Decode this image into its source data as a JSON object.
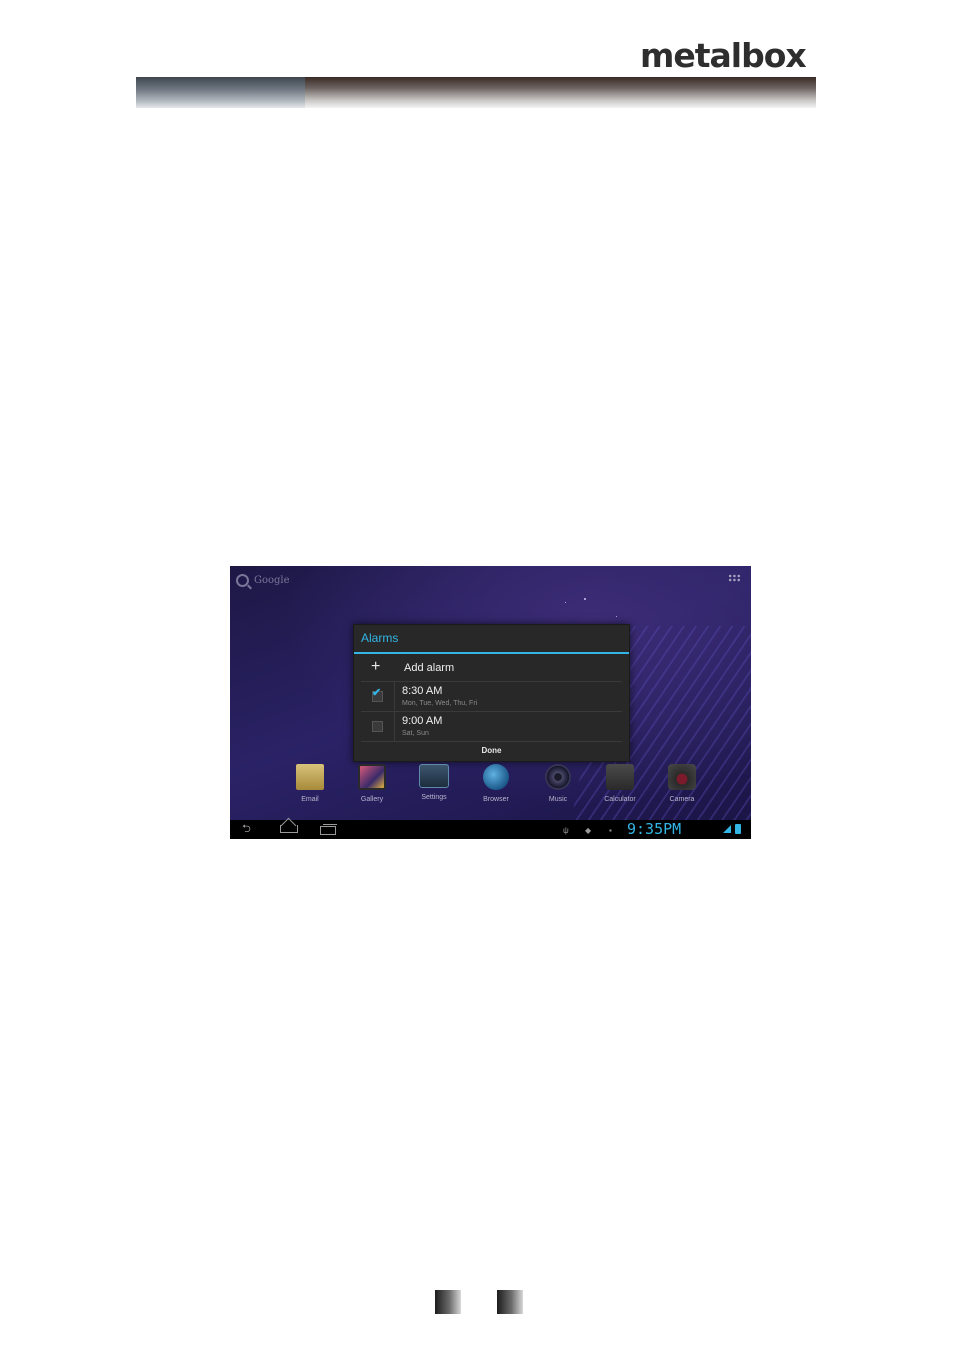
{
  "page": {
    "logo_text": "metalbox"
  },
  "screen": {
    "search_label": "Google",
    "dialog": {
      "title": "Alarms",
      "add_label": "Add alarm",
      "alarms": [
        {
          "time": "8:30 AM",
          "days": "Mon, Tue, Wed, Thu, Fri",
          "enabled": true
        },
        {
          "time": "9:00 AM",
          "days": "Sat, Sun",
          "enabled": false
        }
      ],
      "done_label": "Done"
    },
    "dock": [
      {
        "label": "Email",
        "icon": "email-icon"
      },
      {
        "label": "Gallery",
        "icon": "gallery-icon"
      },
      {
        "label": "Settings",
        "icon": "settings-icon"
      },
      {
        "label": "Browser",
        "icon": "browser-icon"
      },
      {
        "label": "Music",
        "icon": "music-icon"
      },
      {
        "label": "Calculator",
        "icon": "calculator-icon"
      },
      {
        "label": "Camera",
        "icon": "camera-icon"
      }
    ],
    "status": {
      "clock": "9:35PM"
    },
    "colors": {
      "accent": "#33b5e5",
      "dialog_bg": "#282828",
      "wallpaper": "#2a2266"
    }
  }
}
